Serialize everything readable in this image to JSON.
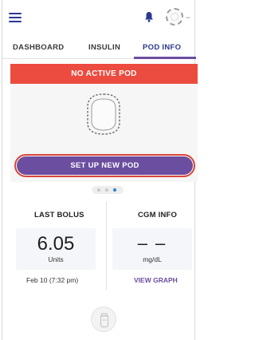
{
  "header": {
    "menu_icon": "hamburger-menu-icon",
    "bell_icon": "bell-icon",
    "pod_status_icon": "pod-status-icon",
    "signal_text": "--"
  },
  "tabs": [
    {
      "label": "DASHBOARD",
      "active": false
    },
    {
      "label": "INSULIN",
      "active": false
    },
    {
      "label": "POD INFO",
      "active": true
    }
  ],
  "pod": {
    "status_banner": "NO ACTIVE POD",
    "setup_button_label": "SET UP NEW POD"
  },
  "pager": {
    "total": 3,
    "active_index": 2
  },
  "last_bolus": {
    "title": "LAST BOLUS",
    "value": "6.05",
    "unit": "Units",
    "date": "Feb 10 (7:32 pm)"
  },
  "cgm": {
    "title": "CGM INFO",
    "value": "– –",
    "unit": "mg/dL",
    "link_label": "VIEW GRAPH"
  },
  "colors": {
    "accent_purple": "#6b4ea0",
    "banner_red": "#ec4b3f",
    "nav_blue": "#2b3990"
  }
}
